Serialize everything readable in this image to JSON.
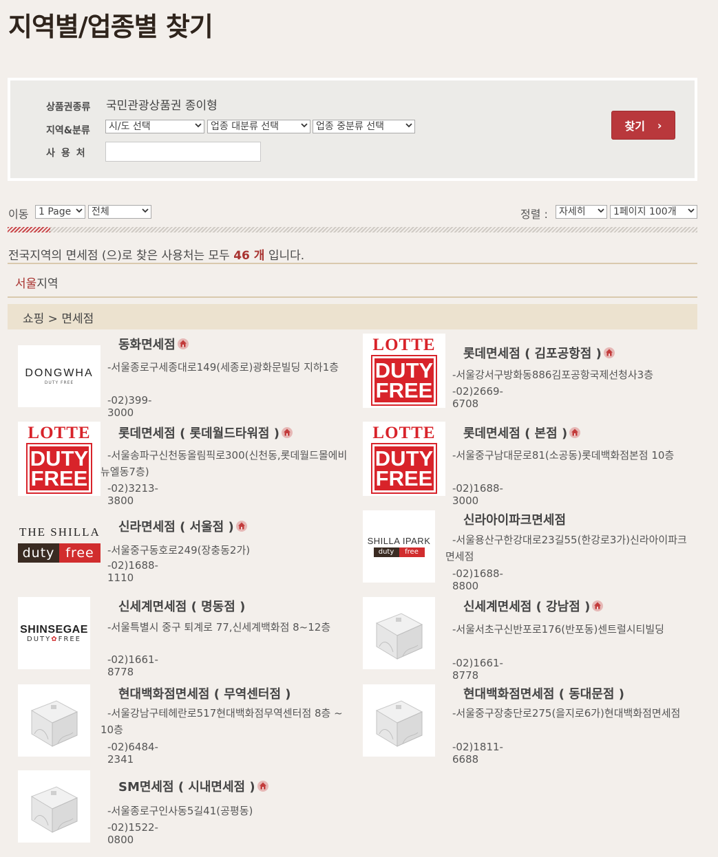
{
  "page_title": "지역별/업종별 찾기",
  "search": {
    "type_label": "상품권종류",
    "type_value": "국민관광상품권 종이형",
    "region_label": "지역&분류",
    "sido_select": "시/도 선택",
    "big_category_select": "업종 대분류 선택",
    "mid_category_select": "업종 중분류 선택",
    "place_label": "사용처",
    "place_value": "",
    "button_label": "찾기",
    "button_arrow": "›"
  },
  "toolbar": {
    "move_label": "이동",
    "page_select": "1 Page",
    "scope_select": "전체",
    "sort_label": "정렬 :",
    "sort_select": "자세히",
    "per_page_select": "1페이지 100개"
  },
  "summary": {
    "prefix": "전국지역의 면세점 (으)로 찾은 사용처는 모두 ",
    "count": "46 개",
    "suffix": " 입니다."
  },
  "region": {
    "name": "서울",
    "suffix": "지역"
  },
  "category": "쇼핑 > 면세점",
  "stores": [
    {
      "name": "동화면세점",
      "home": true,
      "address": "-서울종로구세종대로149(세종로)광화문빌딩 지하1층",
      "phone": "-02)399-3000",
      "logo": "dongwha"
    },
    {
      "name": "롯데면세점 ( 김포공항점 )",
      "home": true,
      "address": "-서울강서구방화동886김포공항국제선청사3층",
      "phone": "-02)2669-6708",
      "logo": "lotte"
    },
    {
      "name": "롯데면세점 ( 롯데월드타워점 )",
      "home": true,
      "address": "-서울송파구신천동올림픽로300(신천동,롯데월드몰에비뉴엘동7층)",
      "phone": "-02)3213-3800",
      "logo": "lotte"
    },
    {
      "name": "롯데면세점 ( 본점 )",
      "home": true,
      "address": "-서울중구남대문로81(소공동)롯데백화점본점 10층",
      "phone": "-02)1688-3000",
      "logo": "lotte"
    },
    {
      "name": "신라면세점 ( 서울점 )",
      "home": true,
      "address": "-서울중구동호로249(장충동2가)",
      "phone": "-02)1688-1110",
      "logo": "shilla"
    },
    {
      "name": "신라아이파크면세점",
      "home": false,
      "address": "-서울용산구한강대로23길55(한강로3가)신라아이파크면세점",
      "phone": "-02)1688-8800",
      "logo": "shilla-ipark"
    },
    {
      "name": "신세계면세점 ( 명동점 )",
      "home": false,
      "address": "-서울특별시 중구 퇴계로 77,신세계백화점 8~12층",
      "phone": "-02)1661-8778",
      "logo": "shinsegae"
    },
    {
      "name": "신세계면세점 ( 강남점 )",
      "home": true,
      "address": "-서울서초구신반포로176(반포동)센트럴시티빌딩",
      "phone": "-02)1661-8778",
      "logo": "placeholder"
    },
    {
      "name": "현대백화점면세점 ( 무역센터점 )",
      "home": false,
      "address": "-서울강남구테헤란로517현대백화점무역센터점 8층 ~ 10층",
      "phone": "-02)6484-2341",
      "logo": "placeholder"
    },
    {
      "name": "현대백화점면세점 ( 동대문점 )",
      "home": false,
      "address": "-서울중구장충단로275(을지로6가)현대백화점면세점",
      "phone": "-02)1811-6688",
      "logo": "placeholder"
    },
    {
      "name": "SM면세점 ( 시내면세점 )",
      "home": true,
      "address": "-서울종로구인사동5길41(공평동)",
      "phone": "-02)1522-0800",
      "logo": "placeholder"
    }
  ],
  "logo_text": {
    "dongwha": "DONGWHA",
    "dongwha_sub": "DUTY FREE",
    "lotte": "LOTTE",
    "lotte_duty": "DUTY",
    "lotte_free": "FREE",
    "shilla": "THE SHILLA",
    "shilla_duty": "duty",
    "shilla_free": "free",
    "shilla_ipark": "SHILLA IPARK",
    "shilla_ipark_duty": "duty",
    "shilla_ipark_free": "free",
    "shinsegae": "SHINSEGAE",
    "shinsegae_duty": "DUTY",
    "shinsegae_free": "FREE"
  },
  "colors": {
    "accent": "#b9383c",
    "highlight": "#a8322f",
    "background": "#f3efeb",
    "category_bar": "#ece2cf"
  }
}
